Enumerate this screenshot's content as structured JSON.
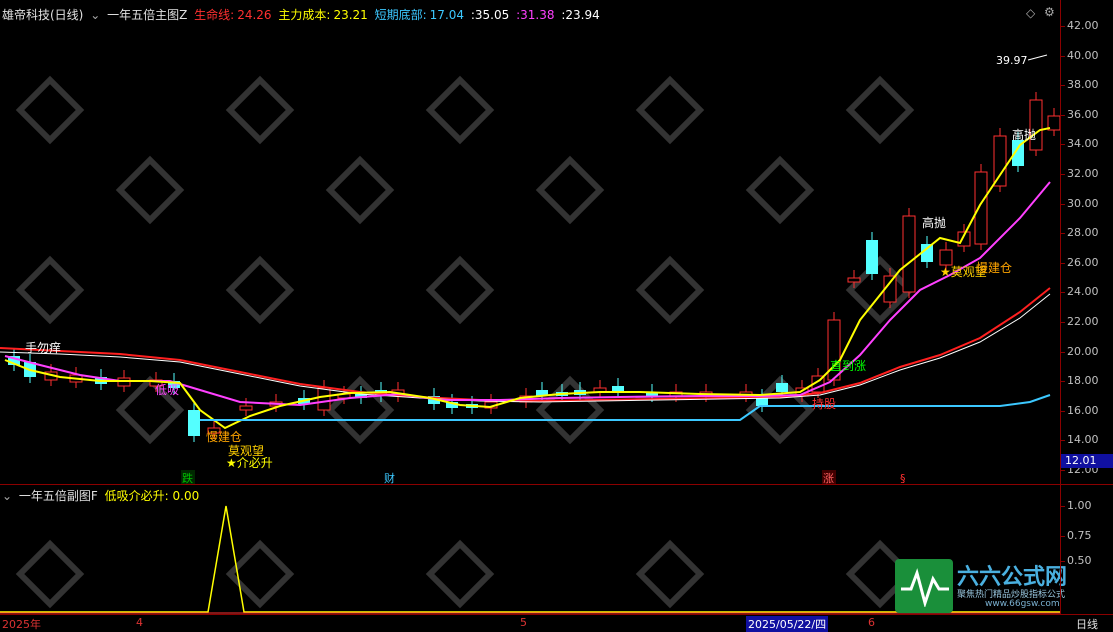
{
  "main_title": {
    "name": "雄帝科技(日线)",
    "formula": "一年五倍主图Z",
    "items": [
      {
        "label": "生命线:",
        "value": "24.26",
        "color": "#ff3030"
      },
      {
        "label": "主力成本:",
        "value": "23.21",
        "color": "#ffff00"
      },
      {
        "label": "短期底部:",
        "value": "17.04",
        "color": "#3cc8ff"
      },
      {
        "label": ":",
        "value": "35.05",
        "color": "#ffffff"
      },
      {
        "label": ":",
        "value": "31.38",
        "color": "#ff40ff"
      },
      {
        "label": ":",
        "value": "23.94",
        "color": "#ffffff"
      }
    ]
  },
  "sub_title": {
    "formula": "一年五倍副图F",
    "label": "低吸介必升:",
    "value": "0.00"
  },
  "price_axis": {
    "ticks": [
      "42.00",
      "40.00",
      "38.00",
      "36.00",
      "34.00",
      "32.00",
      "30.00",
      "28.00",
      "26.00",
      "24.00",
      "22.00",
      "20.00",
      "18.00",
      "16.00",
      "14.00",
      "12.00"
    ],
    "current_price": "12.01"
  },
  "sub_axis": {
    "ticks": [
      "1.00",
      "0.75",
      "0.50"
    ]
  },
  "date_axis": {
    "labels": [
      "2025年",
      "4",
      "5",
      "2025/05/22/四",
      "6"
    ],
    "period": "日线"
  },
  "annotations": {
    "max_price": "39.97",
    "signals": [
      {
        "text": "手勿痒",
        "color": "#ffffff"
      },
      {
        "text": "低吸",
        "color": "#ff40ff"
      },
      {
        "text": "慢建仓",
        "color": "#ffa500"
      },
      {
        "text": "莫观望",
        "color": "#ffd000"
      },
      {
        "text": "★介必升",
        "color": "#ffff00"
      },
      {
        "text": "直到涨",
        "color": "#00ff00"
      },
      {
        "text": "持股",
        "color": "#ff3030"
      },
      {
        "text": "高抛",
        "color": "#ffffff"
      },
      {
        "text": "★莫观望",
        "color": "#ffd000"
      },
      {
        "text": "慢建仓",
        "color": "#ffa500"
      },
      {
        "text": "高抛",
        "color": "#ffffff"
      }
    ],
    "markers": [
      {
        "text": "跌",
        "color": "#00c000"
      },
      {
        "text": "财",
        "color": "#3cc8ff"
      },
      {
        "text": "涨",
        "color": "#ff3030"
      },
      {
        "text": "§",
        "color": "#ff3030"
      }
    ]
  },
  "watermark": {
    "title": "六六公式网",
    "subtitle": "聚焦热门精品炒股指标公式",
    "url": "www.66gsw.com"
  }
}
